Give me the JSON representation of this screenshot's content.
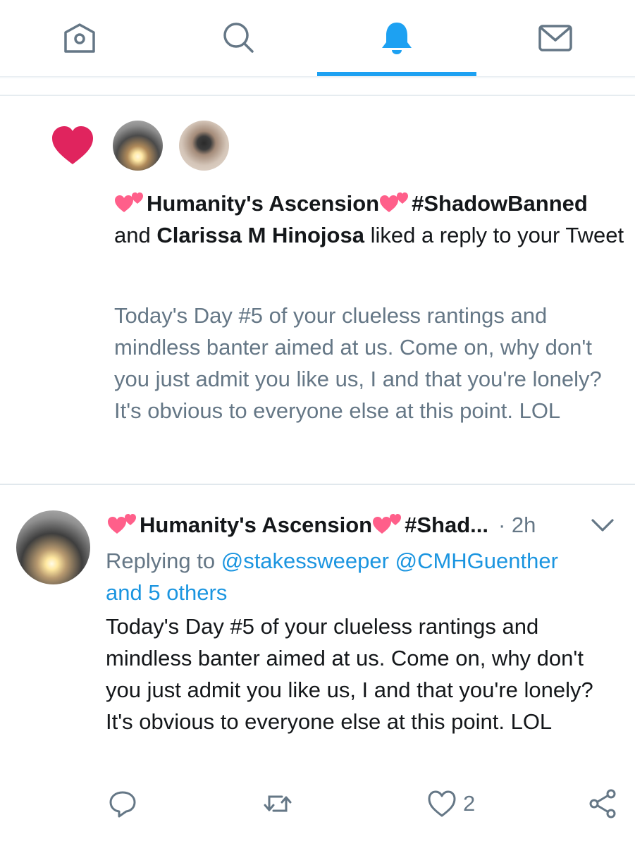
{
  "nav": {
    "tabs": [
      {
        "name": "home",
        "icon": "home-icon",
        "active": false
      },
      {
        "name": "search",
        "icon": "search-icon",
        "active": false
      },
      {
        "name": "notifications",
        "icon": "bell-icon",
        "active": true
      },
      {
        "name": "messages",
        "icon": "envelope-icon",
        "active": false
      }
    ],
    "accent_color": "#1da1f2",
    "inactive_color": "#657786"
  },
  "notification": {
    "icon": "heart-icon",
    "icon_color": "#e0245e",
    "user1_name": "Humanity's Ascension",
    "user1_hashtag": "#ShadowBanned",
    "connector": "and",
    "user2_name": "Clarissa M Hinojosa",
    "action_text": "liked a reply to your Tweet",
    "preview_text": "Today's Day #5 of your clueless rantings and mindless banter aimed at us. Come on, why don't you just admit you like us, I and that you're lonely?  It's obvious to everyone else at this point. LOL"
  },
  "tweet": {
    "author_name": "Humanity's Ascension",
    "author_hashtag_truncated": "#Shad...",
    "separator": "·",
    "timestamp": "2h",
    "replying_prefix": "Replying to",
    "mention1": "@stakessweeper",
    "mention2": "@CMHGuenther",
    "mention_more": "and 5 others",
    "body": "Today's Day #5 of your clueless rantings and mindless banter aimed at us. Come on, why don't you just admit you like us, I and that you're lonely?  It's obvious to everyone else at this point. LOL",
    "like_count": "2",
    "mention_color": "#1b95e0"
  }
}
